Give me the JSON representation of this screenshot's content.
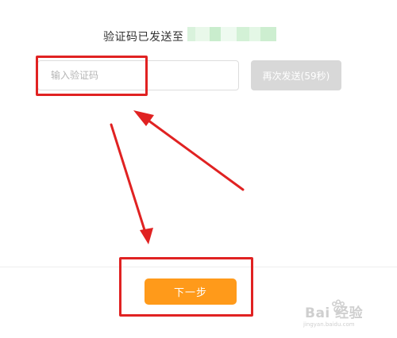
{
  "verification": {
    "prompt": "验证码已发送至",
    "phone_mask_colors": [
      "#d9f2dc",
      "#e9f8ea",
      "#c9edcd",
      "#eefaf0",
      "#d3f1d6",
      "#e4f7e6",
      "#cdeed0"
    ]
  },
  "code_input": {
    "placeholder": "输入验证码",
    "value": ""
  },
  "resend_button": {
    "label": "再次发送(59秒)"
  },
  "next_button": {
    "label": "下一步"
  },
  "annotations": {
    "highlight_color": "#e02222",
    "arrow_icon": "red-arrow-icon"
  },
  "watermark": {
    "brand": "Bai  经验",
    "url": "jingyan.baidu.com"
  },
  "colors": {
    "accent": "#ff9a1a",
    "disabled": "#d8d8d8"
  }
}
